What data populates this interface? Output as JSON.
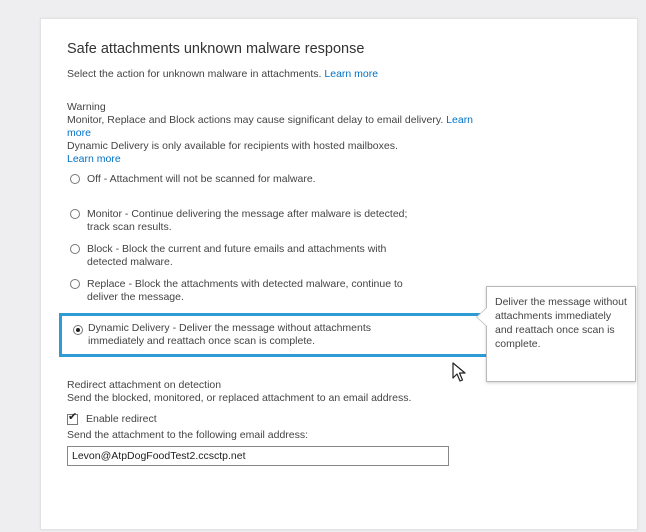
{
  "section": {
    "title": "Safe attachments unknown malware response",
    "subtitle_text": "Select the action for unknown malware in attachments.",
    "subtitle_link": "Learn more"
  },
  "warning": {
    "title": "Warning",
    "line1": "Monitor, Replace and Block actions may cause significant delay to email delivery.",
    "link1": "Learn more",
    "line2": "Dynamic Delivery is only available for recipients with hosted mailboxes.",
    "link2": "Learn more"
  },
  "options": [
    {
      "label": "Off - Attachment will not be scanned for malware.",
      "selected": false
    },
    {
      "label": "Monitor - Continue delivering the message after malware is detected; track scan results.",
      "selected": false
    },
    {
      "label": "Block - Block the current and future emails and attachments with detected malware.",
      "selected": false
    },
    {
      "label": "Replace - Block the attachments with detected malware, continue to deliver the message.",
      "selected": false
    },
    {
      "label": "Dynamic Delivery - Deliver the message without attachments immediately and reattach once scan is complete.",
      "selected": true
    }
  ],
  "redirect": {
    "title": "Redirect attachment on detection",
    "description": "Send the blocked, monitored, or replaced attachment to an email address.",
    "checkbox_label": "Enable redirect",
    "checked": true,
    "send_label": "Send the attachment to the following email address:",
    "email_value": "Levon@AtpDogFoodTest2.ccsctp.net"
  },
  "tooltip": {
    "text": "Deliver the message without attachments immediately and reattach once scan is complete."
  },
  "colors": {
    "link": "#0072c6",
    "selected_border": "#2e9bd4"
  }
}
